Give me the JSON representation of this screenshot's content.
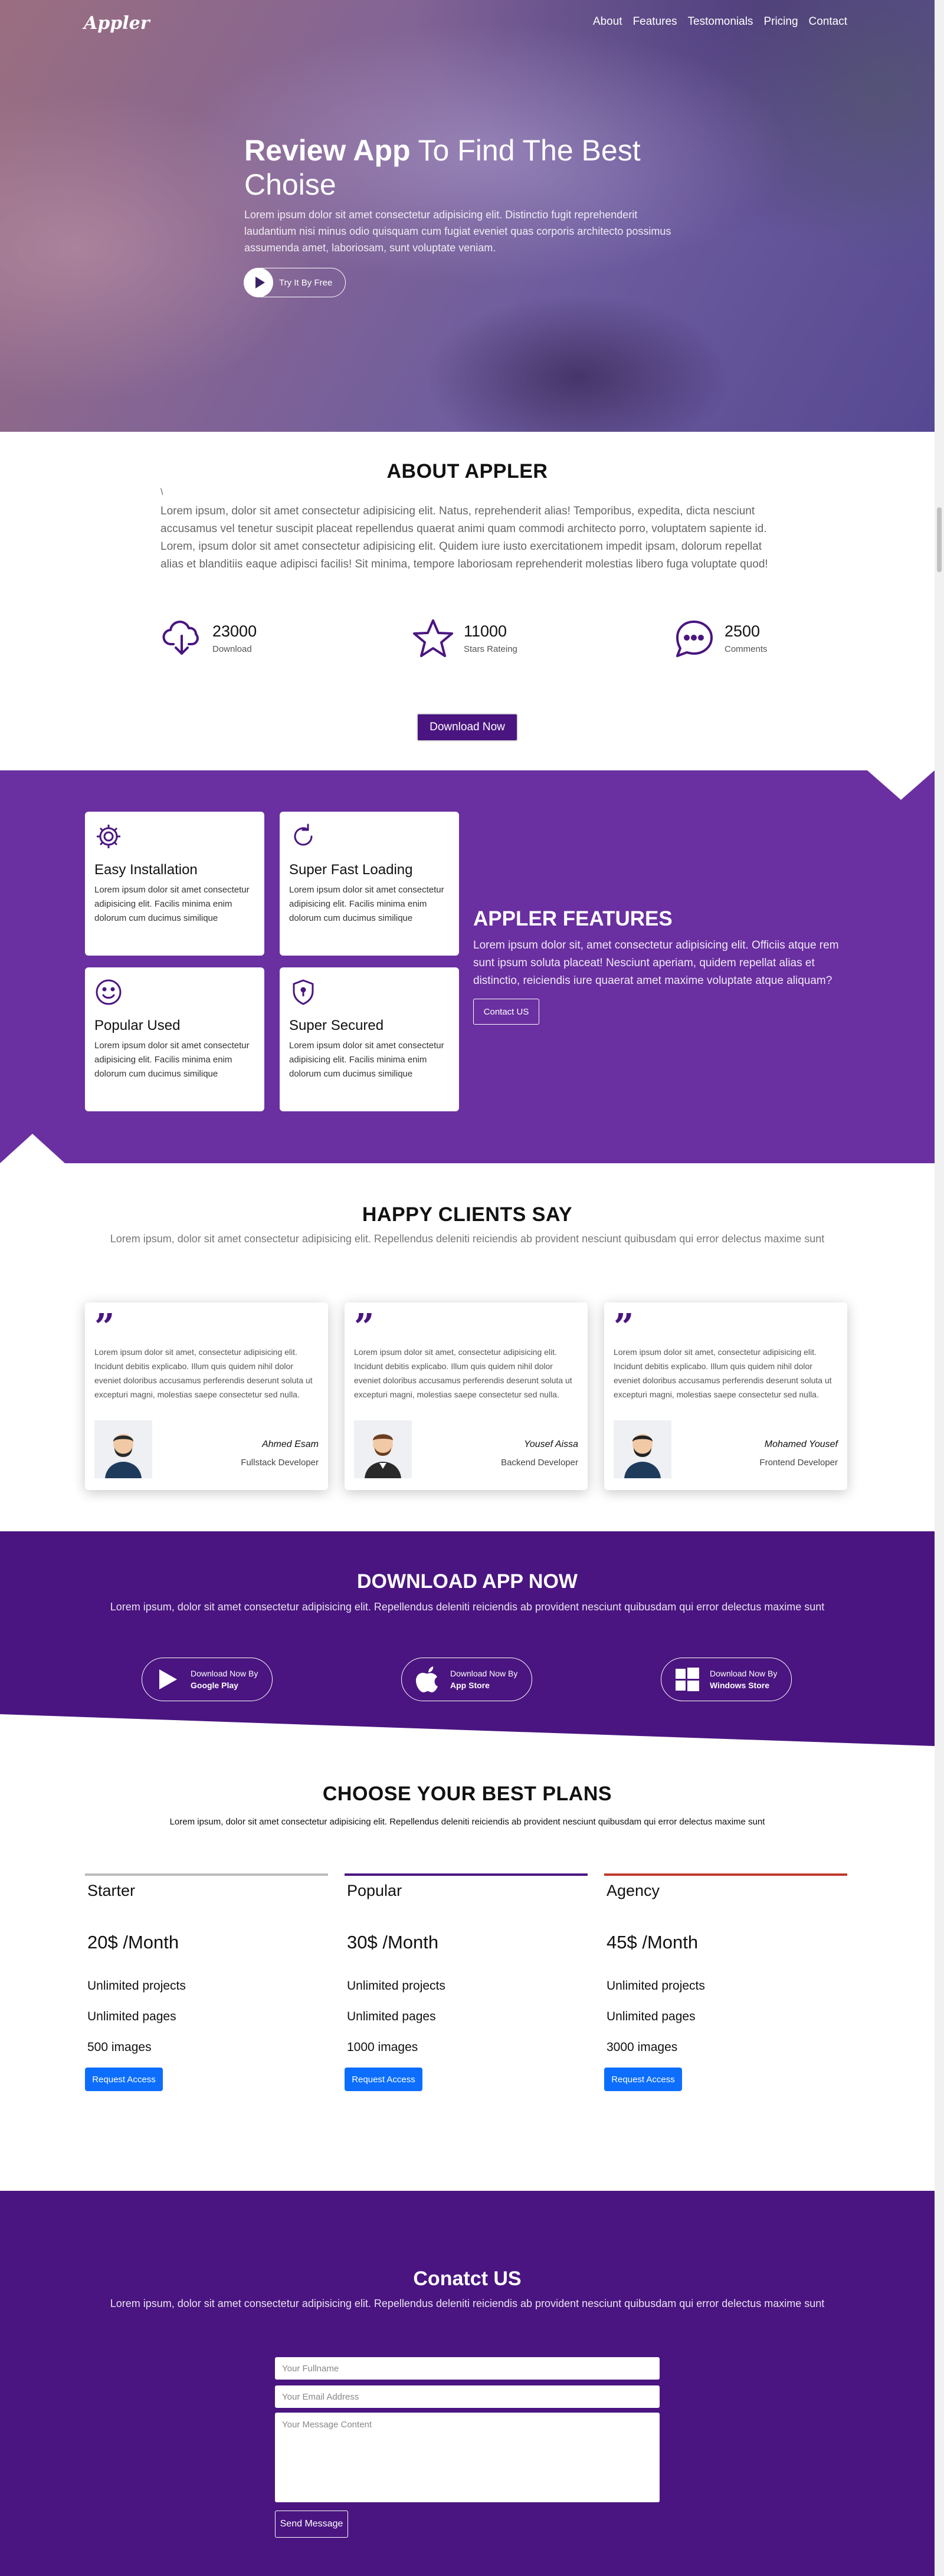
{
  "header": {
    "brand": "Appler",
    "nav": [
      "About",
      "Features",
      "Testomonials",
      "Pricing",
      "Contact"
    ]
  },
  "hero": {
    "title_bold": "Review App",
    "title_light": " To Find The Best Choise",
    "text": "Lorem ipsum dolor sit amet consectetur adipisicing elit. Distinctio fugit reprehenderit laudantium nisi minus odio quisquam cum fugiat eveniet quas corporis architecto possimus assumenda amet, laboriosam, sunt voluptate veniam.",
    "button": "Try It By Free"
  },
  "about": {
    "title": "ABOUT APPLER",
    "mark": "\\",
    "text": "Lorem ipsum, dolor sit amet consectetur adipisicing elit. Natus, reprehenderit alias! Temporibus, expedita, dicta nesciunt accusamus vel tenetur suscipit placeat repellendus quaerat animi quam commodi architecto porro, voluptatem sapiente id. Lorem, ipsum dolor sit amet consectetur adipisicing elit. Quidem iure iusto exercitationem impedit ipsam, dolorum repellat alias et blanditiis eaque adipisci facilis! Sit minima, tempore laboriosam reprehenderit molestias libero fuga voluptate quod!",
    "stats": [
      {
        "icon": "cloud-download-icon",
        "value": "23000",
        "label": "Download"
      },
      {
        "icon": "star-icon",
        "value": "11000",
        "label": "Stars Rateing"
      },
      {
        "icon": "chat-icon",
        "value": "2500",
        "label": "Comments"
      }
    ],
    "button": "Download Now"
  },
  "features": {
    "cards": [
      {
        "icon": "gear-icon",
        "title": "Easy Installation",
        "text": "Lorem ipsum dolor sit amet consectetur adipisicing elit. Facilis minima enim dolorum cum ducimus similique"
      },
      {
        "icon": "refresh-icon",
        "title": "Super Fast Loading",
        "text": "Lorem ipsum dolor sit amet consectetur adipisicing elit. Facilis minima enim dolorum cum ducimus similique"
      },
      {
        "icon": "smile-icon",
        "title": "Popular Used",
        "text": "Lorem ipsum dolor sit amet consectetur adipisicing elit. Facilis minima enim dolorum cum ducimus similique"
      },
      {
        "icon": "shield-icon",
        "title": "Super Secured",
        "text": "Lorem ipsum dolor sit amet consectetur adipisicing elit. Facilis minima enim dolorum cum ducimus similique"
      }
    ],
    "title": "APPLER FEATURES",
    "text": "Lorem ipsum dolor sit, amet consectetur adipisicing elit. Officiis atque rem sunt ipsum soluta placeat! Nesciunt aperiam, quidem repellat alias et distinctio, reiciendis iure quaerat amet maxime voluptate atque aliquam?",
    "button": "Contact US"
  },
  "clients": {
    "title": "HAPPY CLIENTS SAY",
    "subtitle": "Lorem ipsum, dolor sit amet consectetur adipisicing elit. Repellendus deleniti reiciendis ab provident nesciunt quibusdam qui error delectus maxime sunt",
    "quote_mark": "”",
    "items": [
      {
        "text": "Lorem ipsum dolor sit amet, consectetur adipisicing elit. Incidunt debitis explicabo. Illum quis quidem nihil dolor eveniet doloribus accusamus perferendis deserunt soluta ut excepturi magni, molestias saepe consectetur sed nulla.",
        "name": "Ahmed Esam",
        "role": "Fullstack Developer"
      },
      {
        "text": "Lorem ipsum dolor sit amet, consectetur adipisicing elit. Incidunt debitis explicabo. Illum quis quidem nihil dolor eveniet doloribus accusamus perferendis deserunt soluta ut excepturi magni, molestias saepe consectetur sed nulla.",
        "name": "Yousef Aissa",
        "role": "Backend Developer"
      },
      {
        "text": "Lorem ipsum dolor sit amet, consectetur adipisicing elit. Incidunt debitis explicabo. Illum quis quidem nihil dolor eveniet doloribus accusamus perferendis deserunt soluta ut excepturi magni, molestias saepe consectetur sed nulla.",
        "name": "Mohamed Yousef",
        "role": "Frontend Developer"
      }
    ]
  },
  "download": {
    "title": "DOWNLOAD APP NOW",
    "subtitle": "Lorem ipsum, dolor sit amet consectetur adipisicing elit. Repellendus deleniti reiciendis ab provident nesciunt quibusdam qui error delectus maxime sunt",
    "stores": [
      {
        "icon": "play-icon",
        "line1": "Download Now By",
        "line2": "Google Play"
      },
      {
        "icon": "apple-icon",
        "line1": "Download Now By",
        "line2": "App Store"
      },
      {
        "icon": "windows-icon",
        "line1": "Download Now By",
        "line2": "Windows Store"
      }
    ]
  },
  "plans": {
    "title": "CHOOSE YOUR BEST PLANS",
    "subtitle": "Lorem ipsum, dolor sit amet consectetur adipisicing elit. Repellendus deleniti reiciendis ab provident nesciunt quibusdam qui error delectus maxime sunt",
    "items": [
      {
        "name": "Starter",
        "price": "20$ /Month",
        "f1": "Unlimited projects",
        "f2": "Unlimited pages",
        "f3": "500 images",
        "button": "Request Access",
        "color": "#bbbbbb"
      },
      {
        "name": "Popular",
        "price": "30$ /Month",
        "f1": "Unlimited projects",
        "f2": "Unlimited pages",
        "f3": "1000 images",
        "button": "Request Access",
        "color": "#4a1580"
      },
      {
        "name": "Agency",
        "price": "45$ /Month",
        "f1": "Unlimited projects",
        "f2": "Unlimited pages",
        "f3": "3000 images",
        "button": "Request Access",
        "color": "#c0392b"
      }
    ]
  },
  "contact": {
    "title": "Conatct US",
    "subtitle": "Lorem ipsum, dolor sit amet consectetur adipisicing elit. Repellendus deleniti reiciendis ab provident nesciunt quibusdam qui error delectus maxime sunt",
    "name_placeholder": "Your Fullname",
    "email_placeholder": "Your Email Address",
    "message_placeholder": "Your Message Content",
    "button": "Send Message"
  },
  "colors": {
    "primary": "#4a1580",
    "features_bg": "#6a2fa0",
    "button_blue": "#0d6efd"
  }
}
